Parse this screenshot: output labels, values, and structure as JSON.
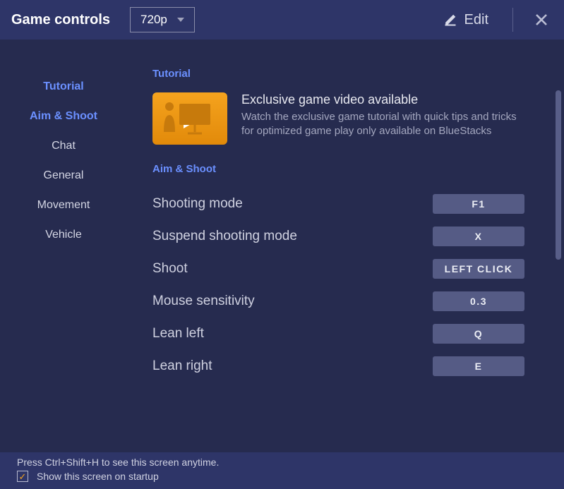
{
  "header": {
    "title": "Game controls",
    "resolution": "720p",
    "edit_label": "Edit"
  },
  "sidebar": {
    "items": [
      {
        "label": "Tutorial",
        "active": true
      },
      {
        "label": "Aim & Shoot",
        "active": true
      },
      {
        "label": "Chat",
        "active": false
      },
      {
        "label": "General",
        "active": false
      },
      {
        "label": "Movement",
        "active": false
      },
      {
        "label": "Vehicle",
        "active": false
      }
    ]
  },
  "sections": {
    "tutorial_head": "Tutorial",
    "tutorial_title": "Exclusive game video available",
    "tutorial_desc": "Watch the exclusive game tutorial with quick tips and tricks for optimized game play only available on BlueStacks",
    "aim_head": "Aim & Shoot",
    "controls": [
      {
        "label": "Shooting mode",
        "key": "F1"
      },
      {
        "label": "Suspend shooting mode",
        "key": "X"
      },
      {
        "label": "Shoot",
        "key": "LEFT CLICK"
      },
      {
        "label": "Mouse sensitivity",
        "key": "0.3"
      },
      {
        "label": "Lean left",
        "key": "Q"
      },
      {
        "label": "Lean right",
        "key": "E"
      }
    ]
  },
  "footer": {
    "hint": "Press Ctrl+Shift+H to see this screen anytime.",
    "checkbox_label": "Show this screen on startup",
    "checked": true
  }
}
